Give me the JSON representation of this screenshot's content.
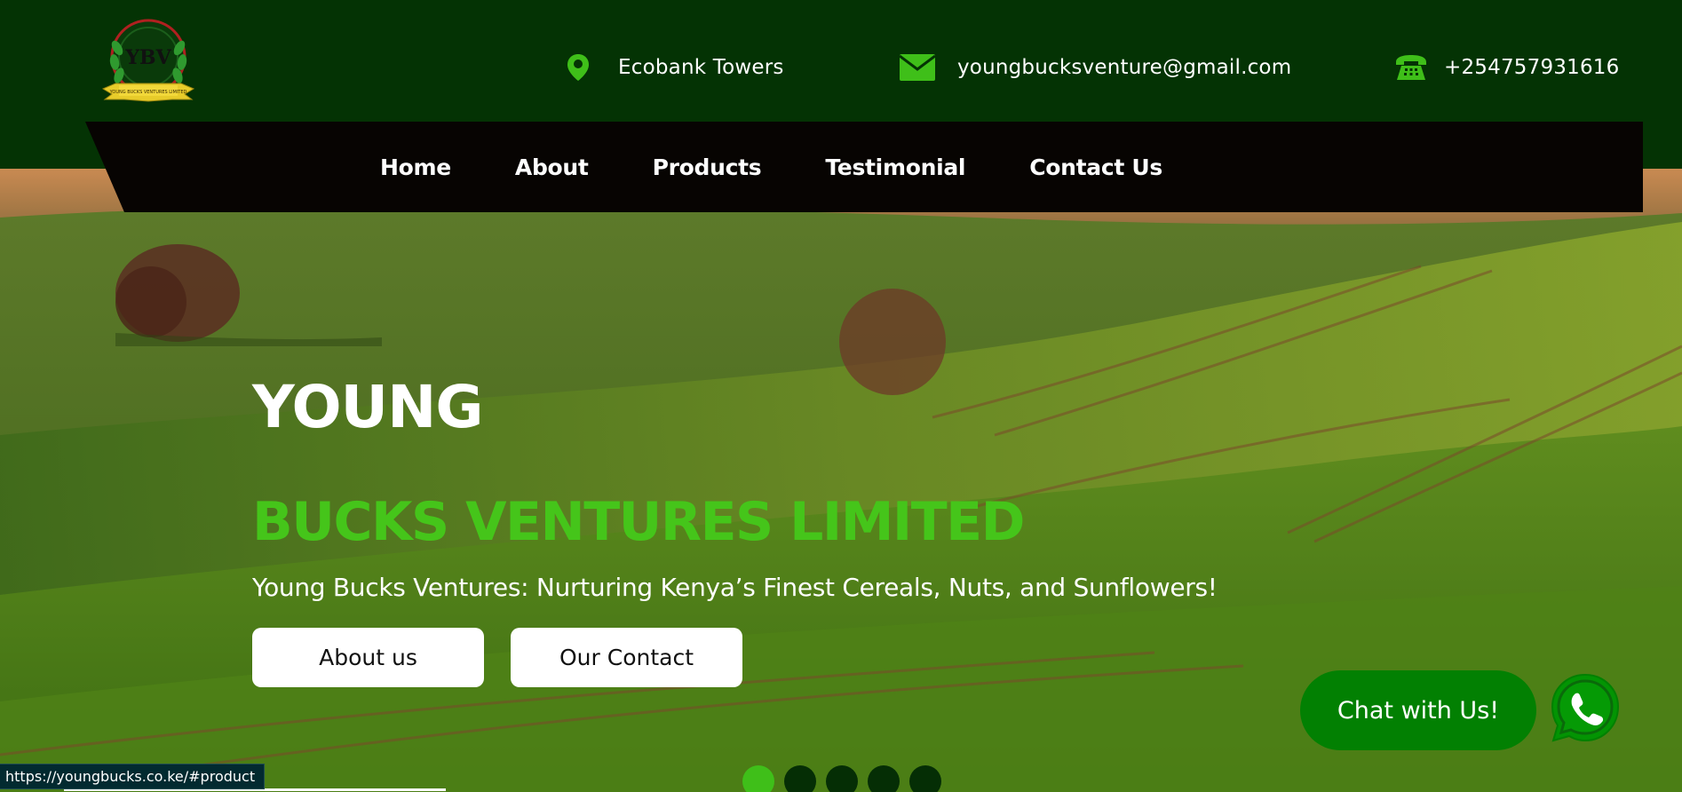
{
  "header": {
    "logo_text": "YBV",
    "logo_ribbon": "YOUNG BUCKS VENTURES LIMITED",
    "location": "Ecobank Towers",
    "email": "youngbucksventure@gmail.com",
    "phone": "+254757931616"
  },
  "nav": {
    "items": [
      {
        "label": "Home"
      },
      {
        "label": "About"
      },
      {
        "label": "Products"
      },
      {
        "label": "Testimonial"
      },
      {
        "label": "Contact Us"
      }
    ]
  },
  "hero": {
    "title": "YOUNG",
    "subtitle": "BUCKS VENTURES LIMITED",
    "tagline": "Young Bucks Ventures: Nurturing Kenya’s Finest Cereals, Nuts, and Sunflowers!",
    "buttons": {
      "about": "About us",
      "contact": "Our Contact"
    }
  },
  "chat": {
    "label": "Chat with Us!"
  },
  "slider": {
    "count": 5,
    "active_index": 0
  },
  "status_bar": {
    "url": "https://youngbucks.co.ke/#product"
  },
  "colors": {
    "header_bg": "#043304",
    "nav_bg": "#070402",
    "accent_green": "#45c51a",
    "chat_green": "#028002"
  },
  "icons": {
    "location": "map-pin-icon",
    "email": "envelope-icon",
    "phone": "telephone-icon",
    "whatsapp": "whatsapp-icon"
  }
}
